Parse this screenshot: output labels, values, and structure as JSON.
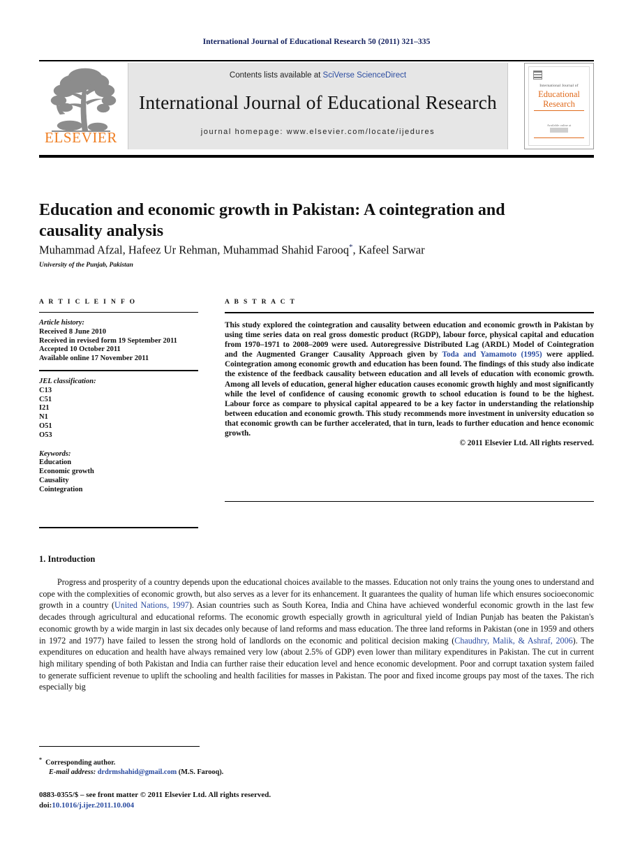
{
  "running_head": "International Journal of Educational Research 50 (2011) 321–335",
  "masthead": {
    "contents_prefix": "Contents lists available at ",
    "sciencedirect": "SciVerse ScienceDirect",
    "journal_name": "International Journal of Educational Research",
    "homepage": "journal homepage: www.elsevier.com/locate/ijedures",
    "publisher_logo_text": "ELSEVIER",
    "cover": {
      "superline": "International Journal of",
      "title_line1": "Educational",
      "title_line2": "Research",
      "lower_caption": "Available online at"
    }
  },
  "article": {
    "title": "Education and economic growth in Pakistan: A cointegration and causality analysis",
    "authors": "Muhammad Afzal, Hafeez Ur Rehman, Muhammad Shahid Farooq",
    "authors_tail": ", Kafeel Sarwar",
    "corresponding_marker": "*",
    "affiliation": "University of the Punjab, Pakistan"
  },
  "info": {
    "heading": "A R T I C L E   I N F O",
    "history_label": "Article history:",
    "history": [
      "Received 8 June 2010",
      "Received in revised form 19 September 2011",
      "Accepted 10 October 2011",
      "Available online 17 November 2011"
    ],
    "jel_label": "JEL classification:",
    "jel": [
      "C13",
      "C51",
      "I21",
      "N1",
      "O51",
      "O53"
    ],
    "keywords_label": "Keywords:",
    "keywords": [
      "Education",
      "Economic growth",
      "Causality",
      "Cointegration"
    ]
  },
  "abstract": {
    "heading": "A B S T R A C T",
    "part1": "This study explored the cointegration and causality between education and economic growth in Pakistan by using time series data on real gross domestic product (RGDP), labour force, physical capital and education from 1970–1971 to 2008–2009 were used. Autoregressive Distributed Lag (ARDL) Model of Cointegration and the Augmented Granger Causality Approach given by ",
    "citation1": "Toda and Yamamoto (1995)",
    "part2": " were applied. Cointegration among economic growth and education has been found. The findings of this study also indicate the existence of the feedback causality between education and all levels of education with economic growth. Among all levels of education, general higher education causes economic growth highly and most significantly while the level of confidence of causing economic growth to school education is found to be the highest. Labour force as compare to physical capital appeared to be a key factor in understanding the relationship between education and economic growth. This study recommends more investment in university education so that economic growth can be further accelerated, that in turn, leads to further education and hence economic growth.",
    "copyright": "© 2011 Elsevier Ltd. All rights reserved."
  },
  "body": {
    "section_heading": "1. Introduction",
    "para1_a": "Progress and prosperity of a country depends upon the educational choices available to the masses. Education not only trains the young ones to understand and cope with the complexities of economic growth, but also serves as a lever for its enhancement. It guarantees the quality of human life which ensures socioeconomic growth in a country (",
    "citation_un": "United Nations, 1997",
    "para1_b": "). Asian countries such as South Korea, India and China have achieved wonderful economic growth in the last few decades through agricultural and educational reforms. The economic growth especially growth in agricultural yield of Indian Punjab has beaten the Pakistan's economic growth by a wide margin in last six decades only because of land reforms and mass education. The three land reforms in Pakistan (one in 1959 and others in 1972 and 1977) have failed to lessen the strong hold of landlords on the economic and political decision making (",
    "citation_chaudhry": "Chaudhry, Malik, & Ashraf, 2006",
    "para1_c": "). The expenditures on education and health have always remained very low (about 2.5% of GDP) even lower than military expenditures in Pakistan. The cut in current high military spending of both Pakistan and India can further raise their education level and hence economic development. Poor and corrupt taxation system failed to generate sufficient revenue to uplift the schooling and health facilities for masses in Pakistan. The poor and fixed income groups pay most of the taxes. The rich especially big"
  },
  "footnote": {
    "corresponding": "Corresponding author.",
    "email_label": "E-mail address:",
    "email": "drdrmshahid@gmail.com",
    "email_owner": "(M.S. Farooq)."
  },
  "colophon": {
    "issn_line": "0883-0355/$ – see front matter © 2011 Elsevier Ltd. All rights reserved.",
    "doi_label": "doi:",
    "doi": "10.1016/j.ijer.2011.10.004"
  },
  "colors": {
    "link": "#2a4ba0",
    "runhead": "#12205e",
    "elsevier_orange": "#ef7d20",
    "cover_orange": "#e06a1b",
    "masthead_gray": "#e6e6e6"
  }
}
